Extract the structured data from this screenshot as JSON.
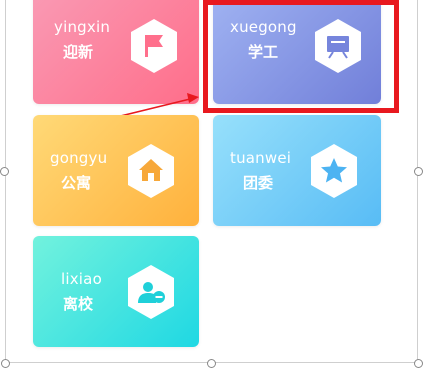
{
  "tiles": {
    "yingxin": {
      "en": "yingxin",
      "zh": "迎新",
      "icon": "flag-icon"
    },
    "xuegong": {
      "en": "xuegong",
      "zh": "学工",
      "icon": "presentation-board-icon"
    },
    "gongyu": {
      "en": "gongyu",
      "zh": "公寓",
      "icon": "house-icon"
    },
    "tuanwei": {
      "en": "tuanwei",
      "zh": "团委",
      "icon": "star-icon"
    },
    "lixiao": {
      "en": "lixiao",
      "zh": "离校",
      "icon": "user-minus-icon"
    }
  },
  "colors": {
    "yingxin": [
      "#f98fae",
      "#ff6f8c"
    ],
    "xuegong": [
      "#9aaef0",
      "#7685dc"
    ],
    "gongyu": [
      "#ffd36a",
      "#ffb23f"
    ],
    "tuanwei": [
      "#8fdcfa",
      "#5bbff5"
    ],
    "lixiao": [
      "#6ff0dc",
      "#1fd9e2"
    ],
    "highlight": "#e8191f",
    "arrow": "#e8191f"
  }
}
